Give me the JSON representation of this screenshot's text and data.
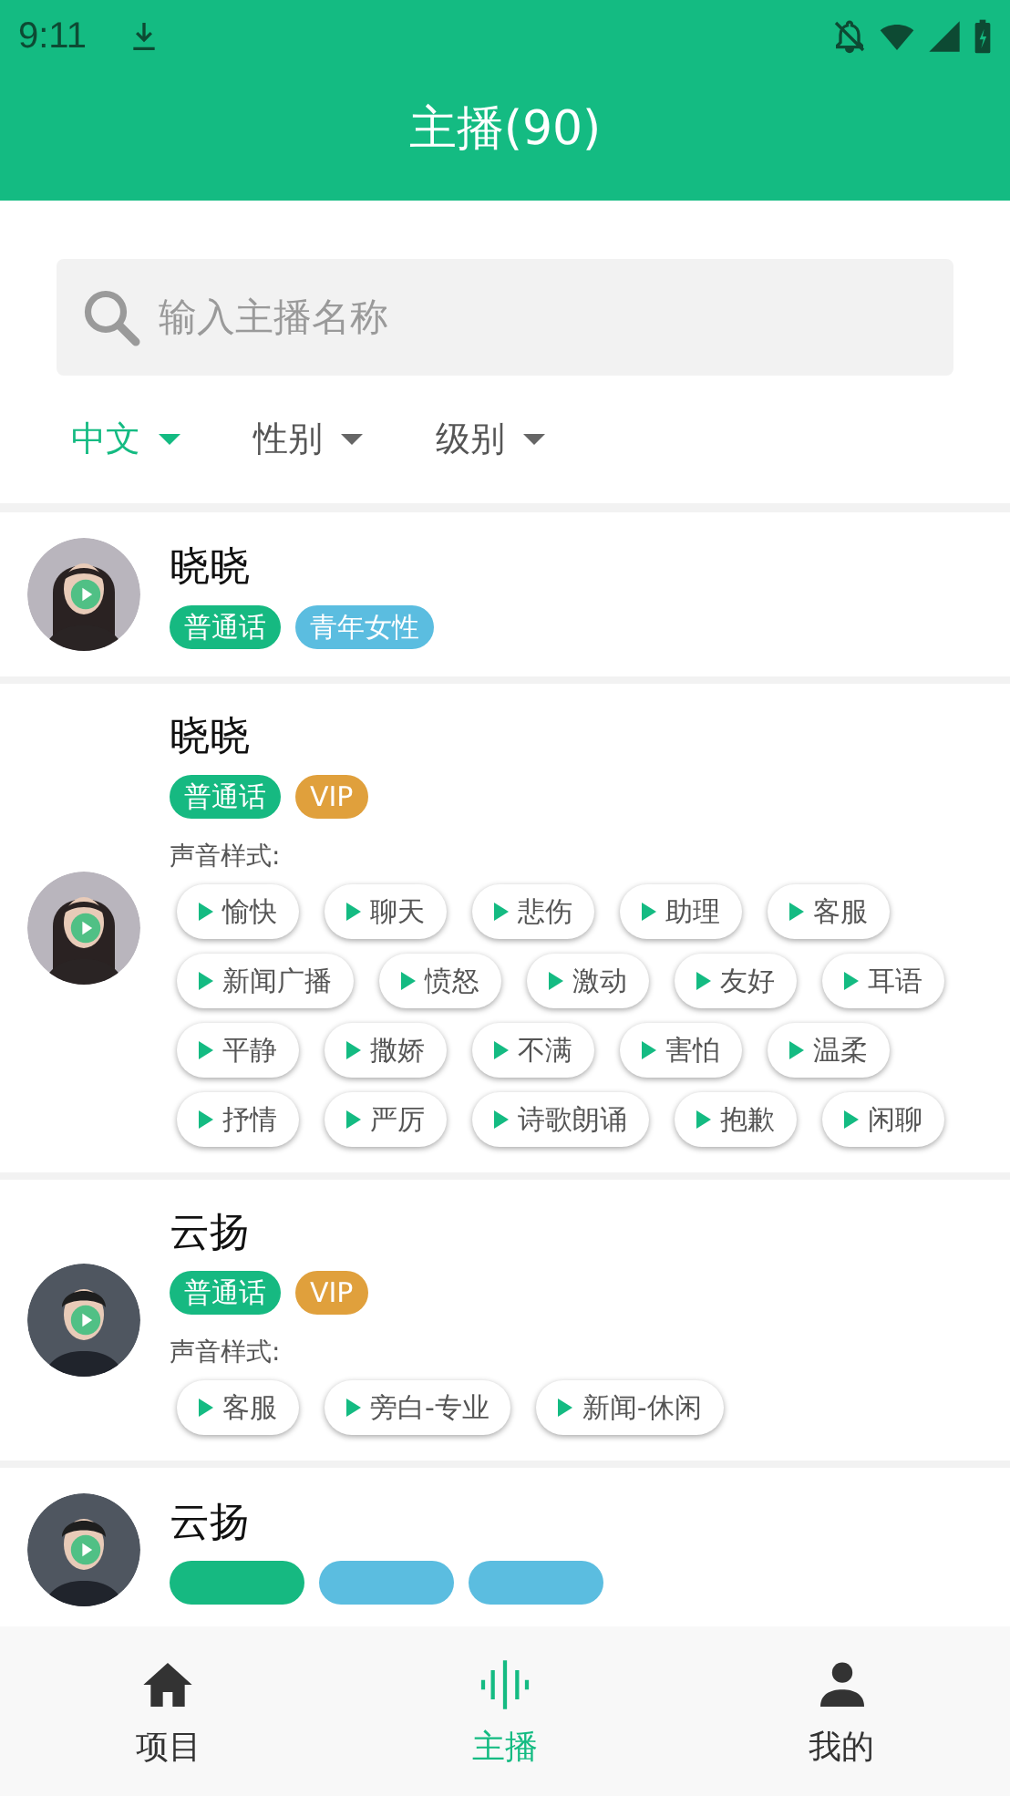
{
  "status_bar": {
    "time": "9:11"
  },
  "header": {
    "title": "主播(90)"
  },
  "search": {
    "placeholder": "输入主播名称"
  },
  "filters": [
    {
      "label": "中文",
      "selected": true
    },
    {
      "label": "性别",
      "selected": false
    },
    {
      "label": "级别",
      "selected": false
    }
  ],
  "anchors": [
    {
      "name": "晓晓",
      "tags": [
        {
          "label": "普通话",
          "color": "#16b981"
        },
        {
          "label": "青年女性",
          "color": "#5bbde0"
        }
      ]
    },
    {
      "name": "晓晓",
      "tags": [
        {
          "label": "普通话",
          "color": "#16b981"
        },
        {
          "label": "VIP",
          "color": "#e0a03c"
        }
      ],
      "styles_label": "声音样式:",
      "styles": [
        "愉快",
        "聊天",
        "悲伤",
        "助理",
        "客服",
        "新闻广播",
        "愤怒",
        "激动",
        "友好",
        "耳语",
        "平静",
        "撒娇",
        "不满",
        "害怕",
        "温柔",
        "抒情",
        "严厉",
        "诗歌朗诵",
        "抱歉",
        "闲聊"
      ]
    },
    {
      "name": "云扬",
      "tags": [
        {
          "label": "普通话",
          "color": "#16b981"
        },
        {
          "label": "VIP",
          "color": "#e0a03c"
        }
      ],
      "styles_label": "声音样式:",
      "styles": [
        "客服",
        "旁白-专业",
        "新闻-休闲"
      ]
    },
    {
      "name": "云扬",
      "tags": [
        {
          "color": "#16b981"
        },
        {
          "color": "#5bbde0"
        },
        {
          "color": "#5bbde0"
        }
      ]
    }
  ],
  "nav": [
    {
      "label": "项目",
      "selected": false
    },
    {
      "label": "主播",
      "selected": true
    },
    {
      "label": "我的",
      "selected": false
    }
  ]
}
